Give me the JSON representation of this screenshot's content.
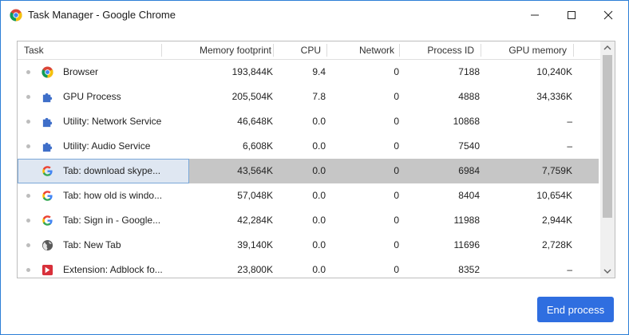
{
  "window": {
    "title": "Task Manager - Google Chrome"
  },
  "table": {
    "columns": [
      "Task",
      "Memory footprint",
      "CPU",
      "Network",
      "Process ID",
      "GPU memory"
    ],
    "rows": [
      {
        "icon": "chrome-icon",
        "task": "Browser",
        "memory": "193,844K",
        "cpu": "9.4",
        "network": "0",
        "pid": "7188",
        "gpu": "10,240K",
        "selected": false
      },
      {
        "icon": "puzzle-icon",
        "task": "GPU Process",
        "memory": "205,504K",
        "cpu": "7.8",
        "network": "0",
        "pid": "4888",
        "gpu": "34,336K",
        "selected": false
      },
      {
        "icon": "puzzle-icon",
        "task": "Utility: Network Service",
        "memory": "46,648K",
        "cpu": "0.0",
        "network": "0",
        "pid": "10868",
        "gpu": "–",
        "selected": false
      },
      {
        "icon": "puzzle-icon",
        "task": "Utility: Audio Service",
        "memory": "6,608K",
        "cpu": "0.0",
        "network": "0",
        "pid": "7540",
        "gpu": "–",
        "selected": false
      },
      {
        "icon": "google-g-icon",
        "task": "Tab: download skype...",
        "memory": "43,564K",
        "cpu": "0.0",
        "network": "0",
        "pid": "6984",
        "gpu": "7,759K",
        "selected": true
      },
      {
        "icon": "google-g-icon",
        "task": "Tab: how old is windo...",
        "memory": "57,048K",
        "cpu": "0.0",
        "network": "0",
        "pid": "8404",
        "gpu": "10,654K",
        "selected": false
      },
      {
        "icon": "google-g-icon",
        "task": "Tab: Sign in - Google...",
        "memory": "42,284K",
        "cpu": "0.0",
        "network": "0",
        "pid": "11988",
        "gpu": "2,944K",
        "selected": false
      },
      {
        "icon": "globe-icon",
        "task": "Tab: New Tab",
        "memory": "39,140K",
        "cpu": "0.0",
        "network": "0",
        "pid": "11696",
        "gpu": "2,728K",
        "selected": false
      },
      {
        "icon": "adblock-icon",
        "task": "Extension: Adblock fo...",
        "memory": "23,800K",
        "cpu": "0.0",
        "network": "0",
        "pid": "8352",
        "gpu": "–",
        "selected": false
      }
    ]
  },
  "footer": {
    "end_process_label": "End process"
  },
  "colors": {
    "accent": "#2f6ee0",
    "selected_row": "#c6c6c6",
    "window_border": "#2d7fd6"
  }
}
